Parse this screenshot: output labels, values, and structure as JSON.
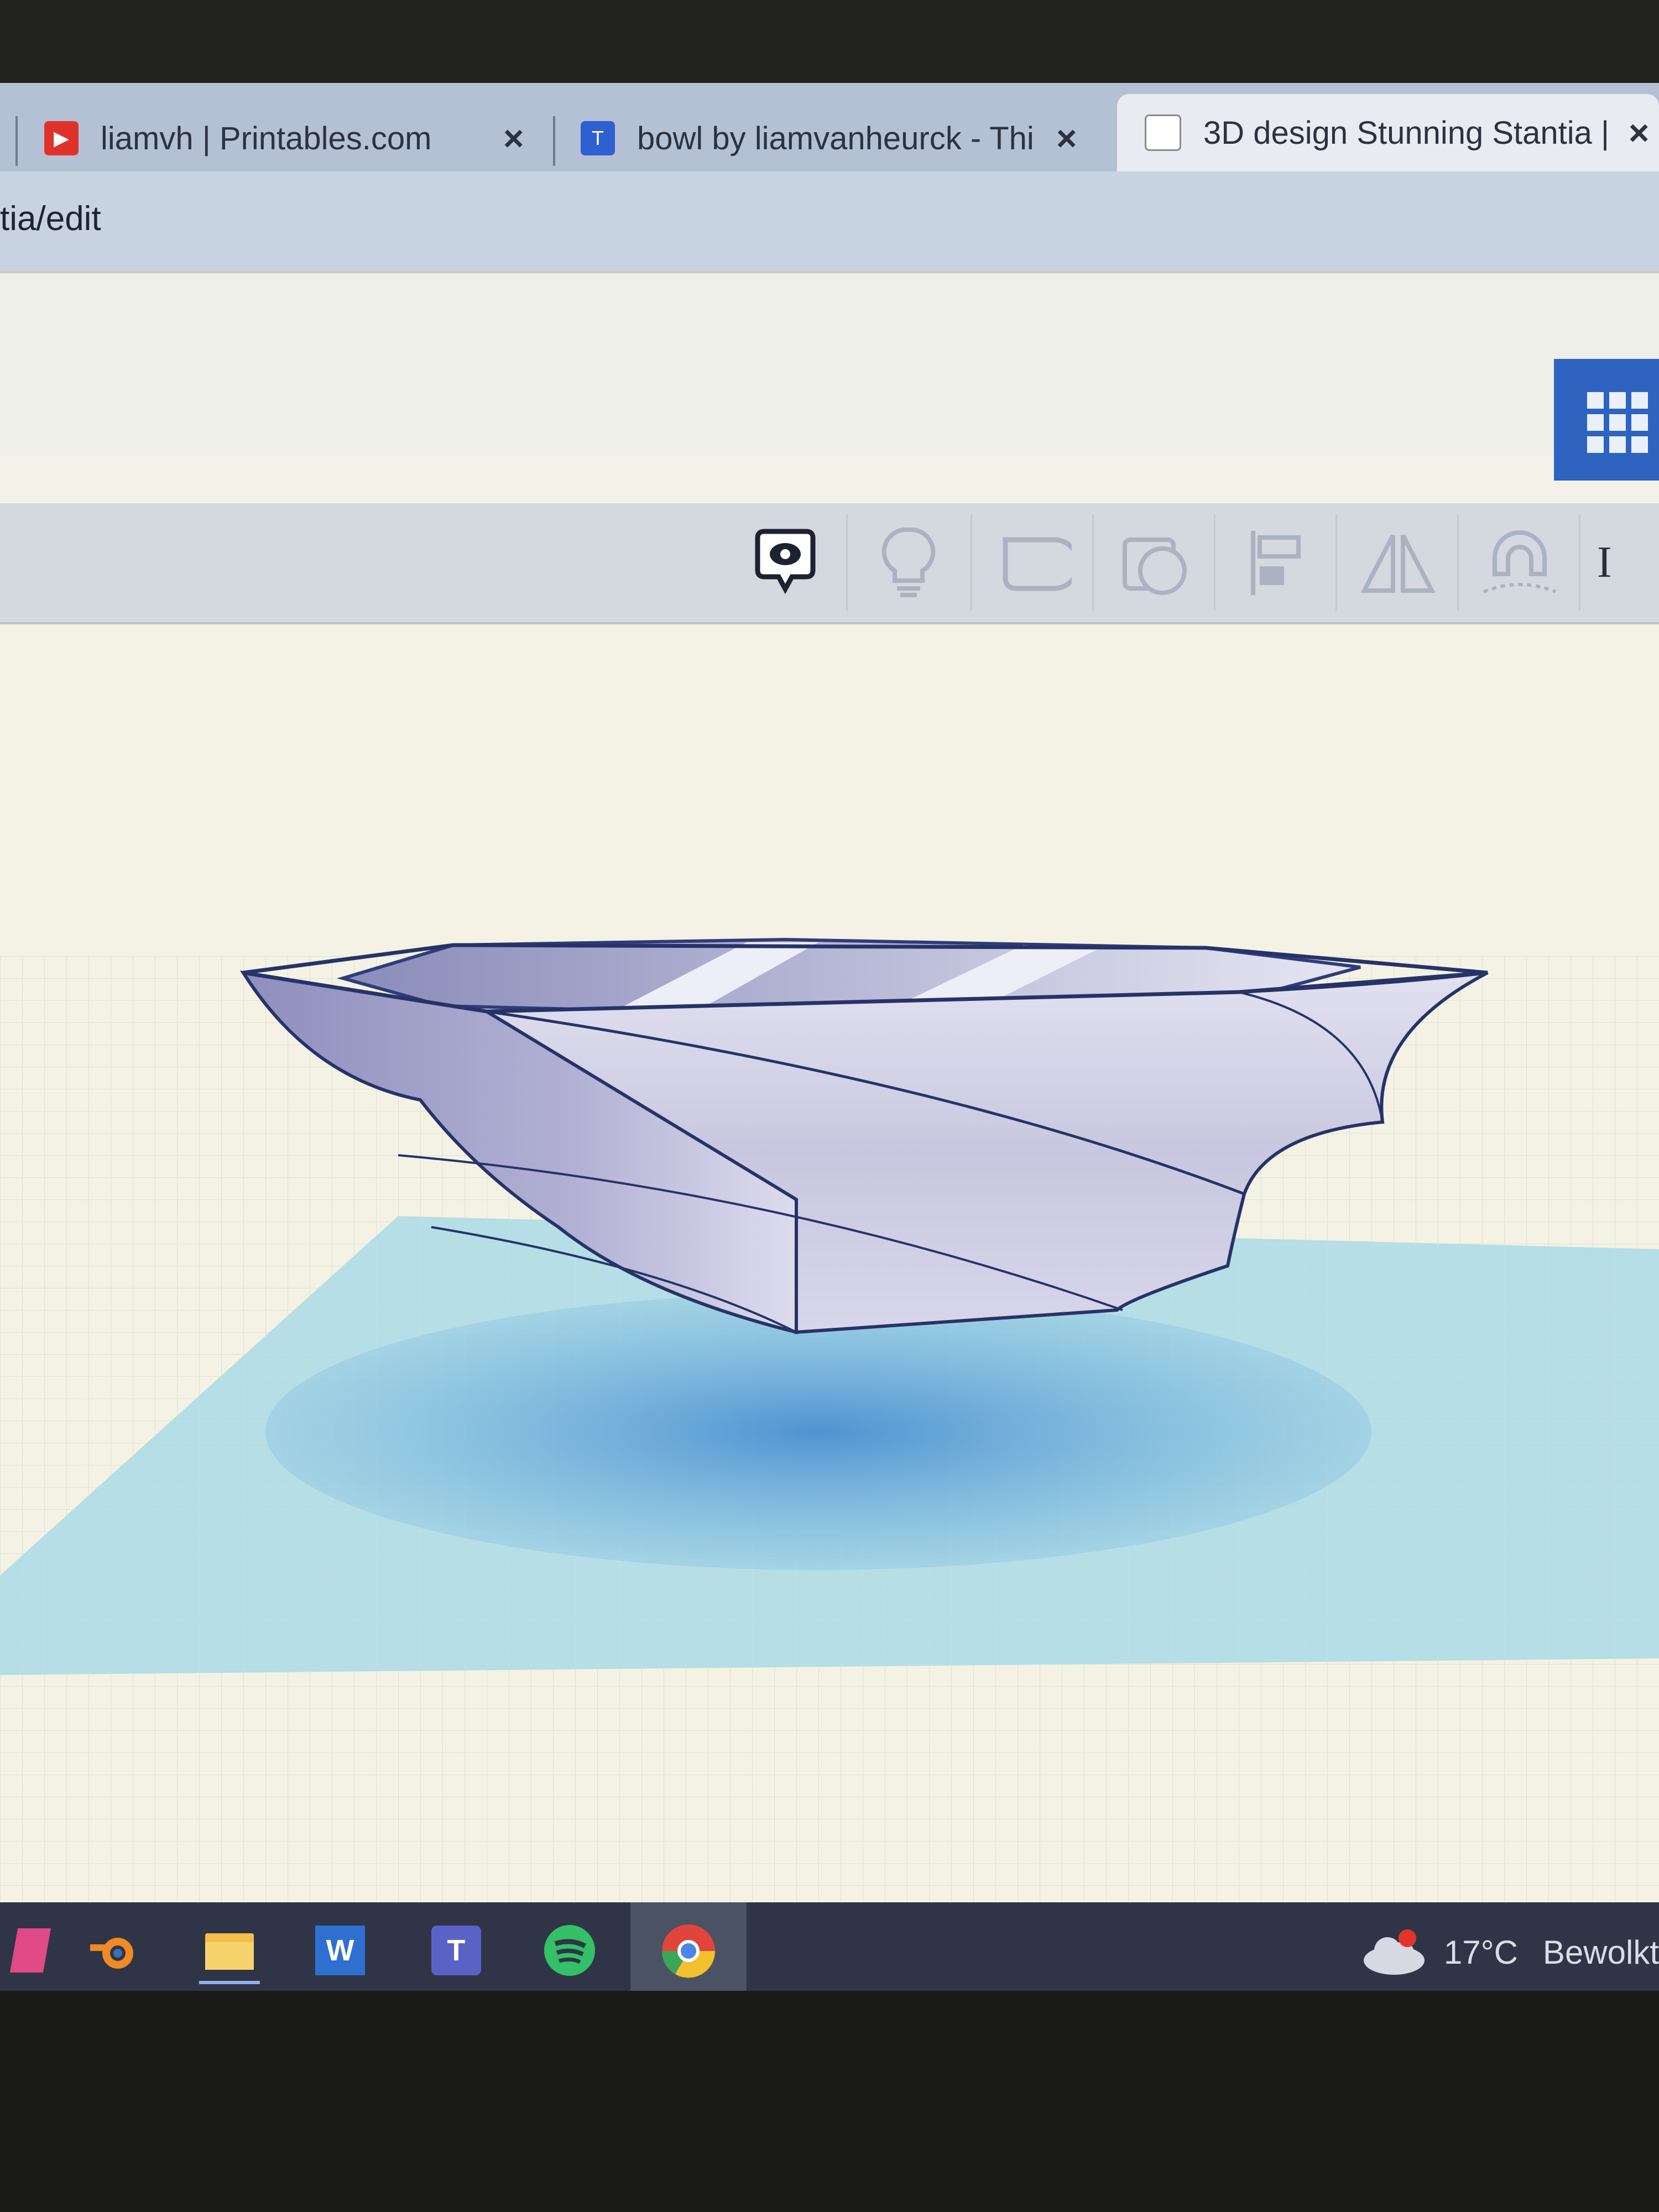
{
  "browser": {
    "tabs": [
      {
        "title": "liamvh | Printables.com",
        "favicon": "printables-icon",
        "color": "#e0322c"
      },
      {
        "title": "bowl by liamvanheurck - Thi",
        "favicon": "thingiverse-icon",
        "color": "#2f5fd0"
      },
      {
        "title": "3D design Stunning Stantia |",
        "favicon": "tinkercad-icon",
        "color": "#d0362c",
        "active": true
      }
    ],
    "url": "tia/edit"
  },
  "app": {
    "menu_icon": "app-grid-icon",
    "toolbar": [
      "notes-icon",
      "light-bulb-icon",
      "shape-icon",
      "hole-icon",
      "align-icon",
      "mirror-icon",
      "snap-magnet-icon",
      "import-icon"
    ],
    "toolbar_cutoff": "I",
    "accent": "#2e63c0"
  },
  "viewport": {
    "object": "twisted hexagonal bowl",
    "object_color": "#c9c7df",
    "workplane_color": "#a9dbe6"
  },
  "taskbar": {
    "icons": [
      "blender-icon",
      "file-explorer-icon",
      "word-icon",
      "teams-icon",
      "spotify-icon",
      "chrome-icon"
    ],
    "weather": {
      "temp": "17°C",
      "desc": "Bewolkt",
      "icon": "cloud-icon"
    }
  }
}
